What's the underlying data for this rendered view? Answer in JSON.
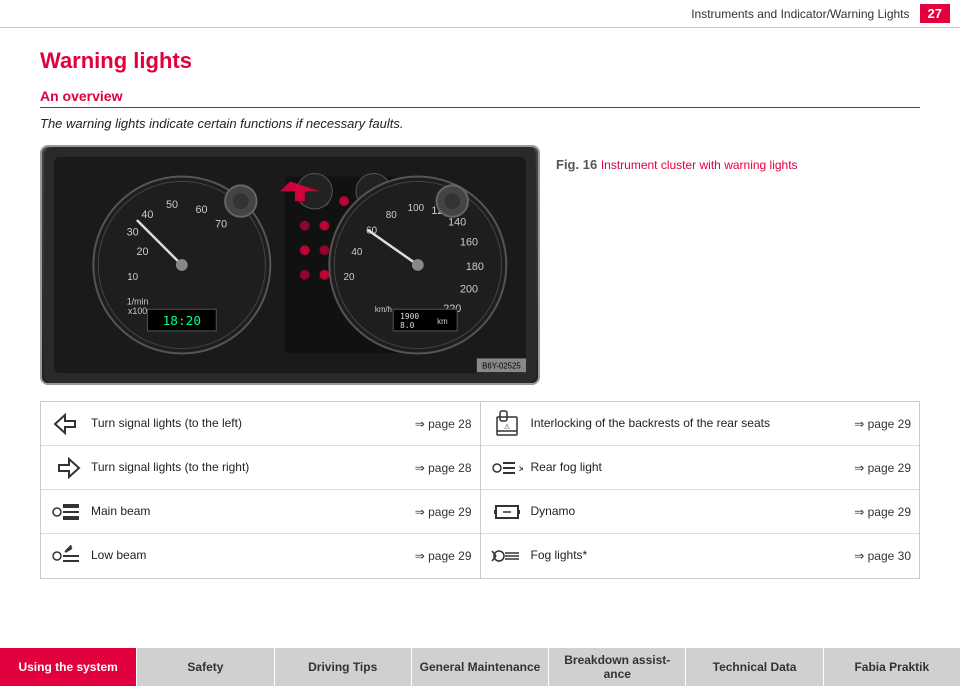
{
  "header": {
    "title": "Instruments and Indicator/Warning Lights",
    "page_number": "27"
  },
  "page": {
    "section_title": "Warning lights",
    "subsection_title": "An overview",
    "intro_text": "The warning lights indicate certain functions if necessary faults.",
    "figure_caption_label": "Fig. 16",
    "figure_caption_text": "Instrument cluster with warning lights",
    "figure_id": "B6Y-02525"
  },
  "warnings_left": [
    {
      "icon": "←",
      "description": "Turn signal lights (to the left)",
      "page_ref": "⇒ page 28"
    },
    {
      "icon": "→",
      "description": "Turn signal lights (to the right)",
      "page_ref": "⇒ page 28"
    },
    {
      "icon": "≡D",
      "description": "Main beam",
      "page_ref": "⇒ page 29"
    },
    {
      "icon": "≈D",
      "description": "Low beam",
      "page_ref": "⇒ page 29"
    }
  ],
  "warnings_right": [
    {
      "icon": "🪑",
      "description": "Interlocking of the backrests of the rear seats",
      "page_ref": "⇒ page 29"
    },
    {
      "icon": "❄",
      "description": "Rear fog light",
      "page_ref": "⇒ page 29"
    },
    {
      "icon": "⬜",
      "description": "Dynamo",
      "page_ref": "⇒ page 29"
    },
    {
      "icon": "🌫",
      "description": "Fog lights*",
      "page_ref": "⇒ page 30"
    }
  ],
  "tabs": [
    {
      "label": "Using the system",
      "active": true
    },
    {
      "label": "Safety",
      "active": false
    },
    {
      "label": "Driving Tips",
      "active": false
    },
    {
      "label": "General Maintenance",
      "active": false
    },
    {
      "label": "Breakdown assist-ance",
      "active": false
    },
    {
      "label": "Technical Data",
      "active": false
    },
    {
      "label": "Fabia Praktik",
      "active": false
    }
  ],
  "colors": {
    "accent": "#e2003e",
    "tab_active_bg": "#e2003e",
    "tab_inactive_bg": "#d0d0d0"
  }
}
